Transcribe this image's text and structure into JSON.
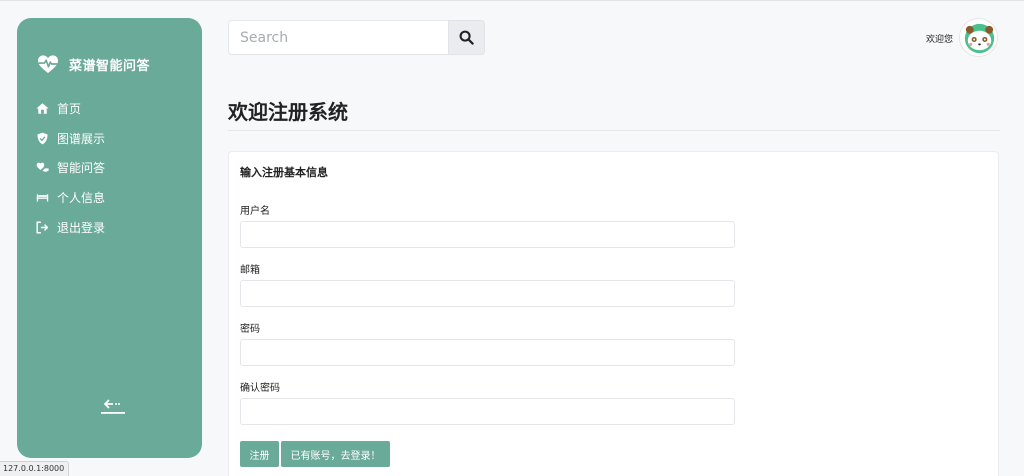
{
  "sidebar": {
    "brand": "菜谱智能问答",
    "items": [
      {
        "label": "首页",
        "icon": "home-icon"
      },
      {
        "label": "图谱展示",
        "icon": "shield-icon"
      },
      {
        "label": "智能问答",
        "icon": "hand-heart-icon"
      },
      {
        "label": "个人信息",
        "icon": "bed-icon"
      },
      {
        "label": "退出登录",
        "icon": "logout-icon"
      }
    ],
    "collapse_icon": "arrow-left-icon"
  },
  "header": {
    "search": {
      "placeholder": "Search",
      "value": ""
    },
    "welcome": "欢迎您"
  },
  "page": {
    "title": "欢迎注册系统"
  },
  "form": {
    "title": "输入注册基本信息",
    "fields": [
      {
        "label": "用户名",
        "value": ""
      },
      {
        "label": "邮箱",
        "value": ""
      },
      {
        "label": "密码",
        "value": ""
      },
      {
        "label": "确认密码",
        "value": ""
      }
    ],
    "register_label": "注册",
    "login_label": "已有账号，去登录！"
  },
  "status_bar": {
    "text": "127.0.0.1:8000"
  },
  "colors": {
    "accent": "#6aaa98",
    "background": "#f7f8fa"
  }
}
